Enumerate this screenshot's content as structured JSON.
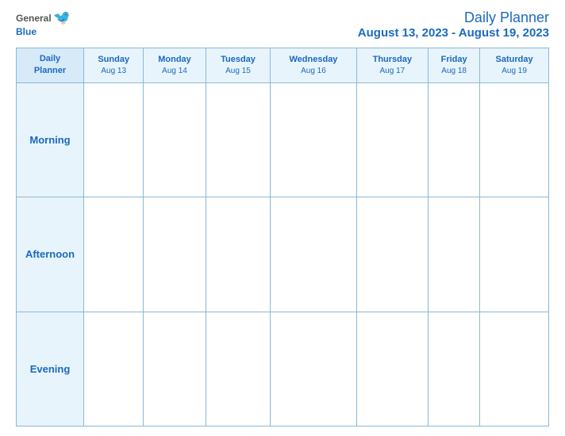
{
  "header": {
    "logo_general": "General",
    "logo_blue": "Blue",
    "title": "Daily Planner",
    "date_range": "August 13, 2023 - August 19, 2023"
  },
  "table": {
    "header_row_label": "Daily\nPlanner",
    "days": [
      {
        "name": "Sunday",
        "date": "Aug 13"
      },
      {
        "name": "Monday",
        "date": "Aug 14"
      },
      {
        "name": "Tuesday",
        "date": "Aug 15"
      },
      {
        "name": "Wednesday",
        "date": "Aug 16"
      },
      {
        "name": "Thursday",
        "date": "Aug 17"
      },
      {
        "name": "Friday",
        "date": "Aug 18"
      },
      {
        "name": "Saturday",
        "date": "Aug 19"
      }
    ],
    "rows": [
      {
        "label": "Morning"
      },
      {
        "label": "Afternoon"
      },
      {
        "label": "Evening"
      }
    ]
  }
}
